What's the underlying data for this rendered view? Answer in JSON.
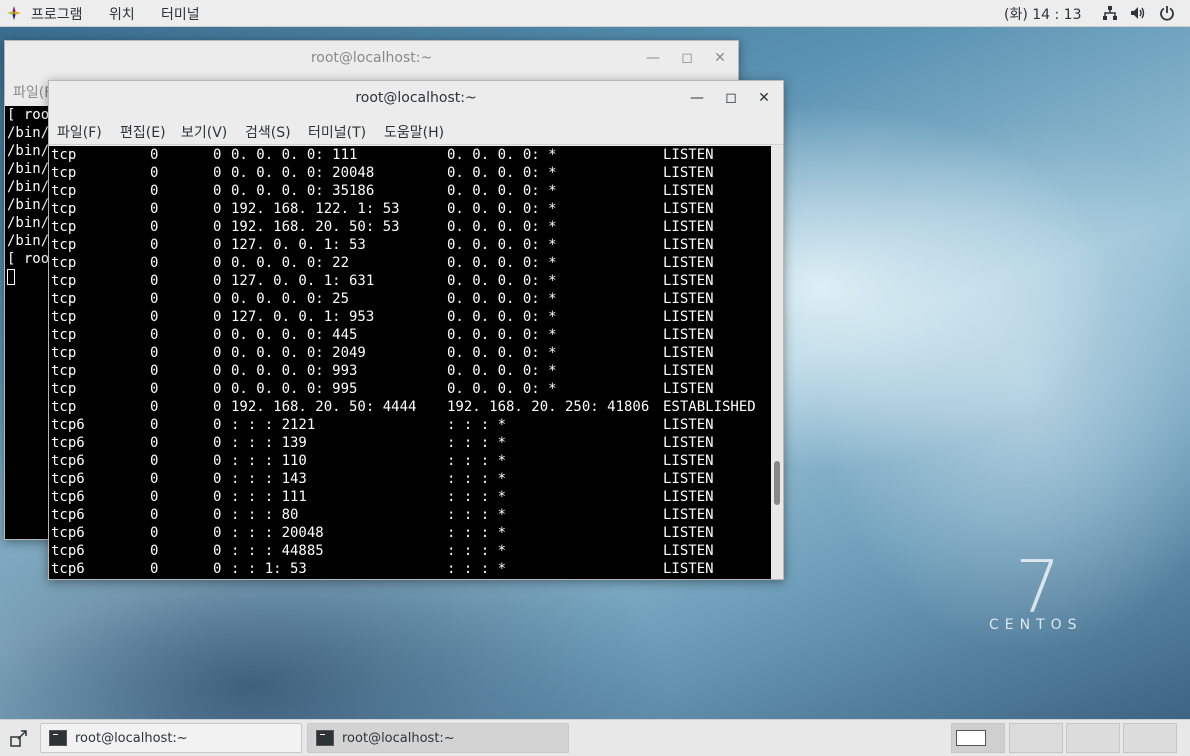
{
  "topbar": {
    "menus": [
      "프로그램",
      "위치",
      "터미널"
    ],
    "clock": "(화) 14 : 13",
    "tray_icons": [
      "network-icon",
      "volume-icon",
      "power-icon"
    ]
  },
  "desktop": {
    "logo_number": "7",
    "logo_text": "CENTOS"
  },
  "back_window": {
    "title": "root@localhost:~",
    "menu_fragment": "파일(F",
    "lines": [
      "[ root",
      "/bin/",
      "/bin/",
      "/bin/",
      "/bin/",
      "/bin/",
      "/bin/",
      "/bin/",
      "[ root"
    ]
  },
  "front_window": {
    "title": "root@localhost:~",
    "menus": [
      "파일(F)",
      "편집(E)",
      "보기(V)",
      "검색(S)",
      "터미널(T)",
      "도움말(H)"
    ],
    "rows": [
      [
        "tcp",
        "0",
        "0",
        "0. 0. 0. 0: 111",
        "0. 0. 0. 0: *",
        "LISTEN"
      ],
      [
        "tcp",
        "0",
        "0",
        "0. 0. 0. 0: 20048",
        "0. 0. 0. 0: *",
        "LISTEN"
      ],
      [
        "tcp",
        "0",
        "0",
        "0. 0. 0. 0: 35186",
        "0. 0. 0. 0: *",
        "LISTEN"
      ],
      [
        "tcp",
        "0",
        "0",
        "192. 168. 122. 1: 53",
        "0. 0. 0. 0: *",
        "LISTEN"
      ],
      [
        "tcp",
        "0",
        "0",
        "192. 168. 20. 50: 53",
        "0. 0. 0. 0: *",
        "LISTEN"
      ],
      [
        "tcp",
        "0",
        "0",
        "127. 0. 0. 1: 53",
        "0. 0. 0. 0: *",
        "LISTEN"
      ],
      [
        "tcp",
        "0",
        "0",
        "0. 0. 0. 0: 22",
        "0. 0. 0. 0: *",
        "LISTEN"
      ],
      [
        "tcp",
        "0",
        "0",
        "127. 0. 0. 1: 631",
        "0. 0. 0. 0: *",
        "LISTEN"
      ],
      [
        "tcp",
        "0",
        "0",
        "0. 0. 0. 0: 25",
        "0. 0. 0. 0: *",
        "LISTEN"
      ],
      [
        "tcp",
        "0",
        "0",
        "127. 0. 0. 1: 953",
        "0. 0. 0. 0: *",
        "LISTEN"
      ],
      [
        "tcp",
        "0",
        "0",
        "0. 0. 0. 0: 445",
        "0. 0. 0. 0: *",
        "LISTEN"
      ],
      [
        "tcp",
        "0",
        "0",
        "0. 0. 0. 0: 2049",
        "0. 0. 0. 0: *",
        "LISTEN"
      ],
      [
        "tcp",
        "0",
        "0",
        "0. 0. 0. 0: 993",
        "0. 0. 0. 0: *",
        "LISTEN"
      ],
      [
        "tcp",
        "0",
        "0",
        "0. 0. 0. 0: 995",
        "0. 0. 0. 0: *",
        "LISTEN"
      ],
      [
        "tcp",
        "0",
        "0",
        "192. 168. 20. 50: 4444",
        "192. 168. 20. 250: 41806",
        "ESTABLISHED"
      ],
      [
        "tcp6",
        "0",
        "0",
        ": : : 2121",
        ": : : *",
        "LISTEN"
      ],
      [
        "tcp6",
        "0",
        "0",
        ": : : 139",
        ": : : *",
        "LISTEN"
      ],
      [
        "tcp6",
        "0",
        "0",
        ": : : 110",
        ": : : *",
        "LISTEN"
      ],
      [
        "tcp6",
        "0",
        "0",
        ": : : 143",
        ": : : *",
        "LISTEN"
      ],
      [
        "tcp6",
        "0",
        "0",
        ": : : 111",
        ": : : *",
        "LISTEN"
      ],
      [
        "tcp6",
        "0",
        "0",
        ": : : 80",
        ": : : *",
        "LISTEN"
      ],
      [
        "tcp6",
        "0",
        "0",
        ": : : 20048",
        ": : : *",
        "LISTEN"
      ],
      [
        "tcp6",
        "0",
        "0",
        ": : : 44885",
        ": : : *",
        "LISTEN"
      ],
      [
        "tcp6",
        "0",
        "0",
        ": : 1: 53",
        ": : : *",
        "LISTEN"
      ]
    ]
  },
  "taskbar": {
    "tasks": [
      "root@localhost:~",
      "root@localhost:~"
    ]
  }
}
